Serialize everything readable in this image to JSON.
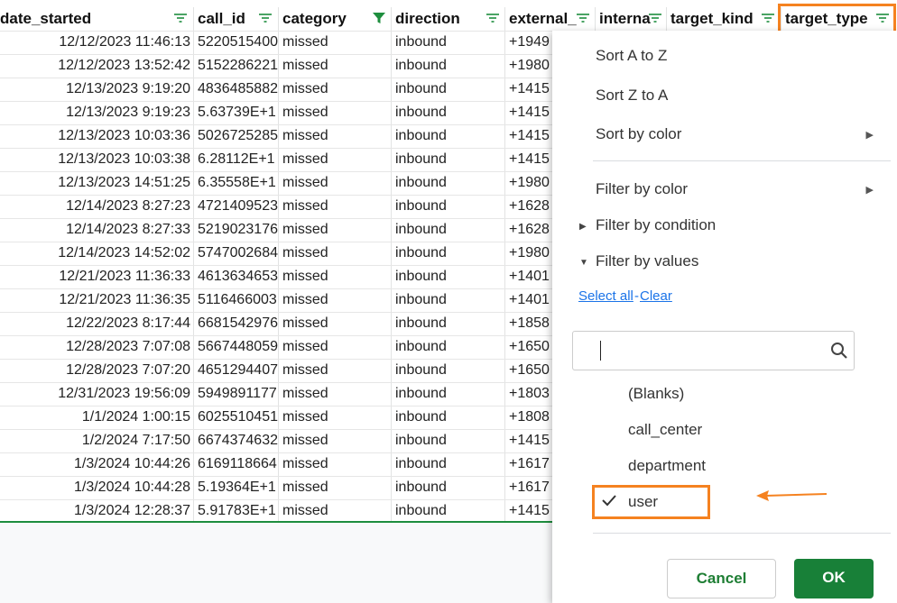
{
  "columns": [
    {
      "label": "date_started"
    },
    {
      "label": "call_id"
    },
    {
      "label": "category"
    },
    {
      "label": "direction"
    },
    {
      "label": "external_"
    },
    {
      "label": "interna"
    },
    {
      "label": "target_kind"
    },
    {
      "label": "target_type"
    }
  ],
  "rows": [
    [
      "12/12/2023 11:46:13",
      "5220515400",
      "missed",
      "inbound",
      "+1949"
    ],
    [
      "12/12/2023 13:52:42",
      "5152286221",
      "missed",
      "inbound",
      "+1980"
    ],
    [
      "12/13/2023 9:19:20",
      "4836485882",
      "missed",
      "inbound",
      "+1415"
    ],
    [
      "12/13/2023 9:19:23",
      "5.63739E+1",
      "missed",
      "inbound",
      "+1415"
    ],
    [
      "12/13/2023 10:03:36",
      "5026725285",
      "missed",
      "inbound",
      "+1415"
    ],
    [
      "12/13/2023 10:03:38",
      "6.28112E+1",
      "missed",
      "inbound",
      "+1415"
    ],
    [
      "12/13/2023 14:51:25",
      "6.35558E+1",
      "missed",
      "inbound",
      "+1980"
    ],
    [
      "12/14/2023 8:27:23",
      "4721409523",
      "missed",
      "inbound",
      "+1628"
    ],
    [
      "12/14/2023 8:27:33",
      "5219023176",
      "missed",
      "inbound",
      "+1628"
    ],
    [
      "12/14/2023 14:52:02",
      "5747002684",
      "missed",
      "inbound",
      "+1980"
    ],
    [
      "12/21/2023 11:36:33",
      "4613634653",
      "missed",
      "inbound",
      "+1401"
    ],
    [
      "12/21/2023 11:36:35",
      "5116466003",
      "missed",
      "inbound",
      "+1401"
    ],
    [
      "12/22/2023 8:17:44",
      "6681542976",
      "missed",
      "inbound",
      "+1858"
    ],
    [
      "12/28/2023 7:07:08",
      "5667448059",
      "missed",
      "inbound",
      "+1650"
    ],
    [
      "12/28/2023 7:07:20",
      "4651294407",
      "missed",
      "inbound",
      "+1650"
    ],
    [
      "12/31/2023 19:56:09",
      "5949891177",
      "missed",
      "inbound",
      "+1803"
    ],
    [
      "1/1/2024 1:00:15",
      "6025510451",
      "missed",
      "inbound",
      "+1808"
    ],
    [
      "1/2/2024 7:17:50",
      "6674374632",
      "missed",
      "inbound",
      "+1415"
    ],
    [
      "1/3/2024 10:44:26",
      "6169118664",
      "missed",
      "inbound",
      "+1617"
    ],
    [
      "1/3/2024 10:44:28",
      "5.19364E+1",
      "missed",
      "inbound",
      "+1617"
    ],
    [
      "1/3/2024 12:28:37",
      "5.91783E+1",
      "missed",
      "inbound",
      "+1415"
    ]
  ],
  "menu": {
    "sort_az": "Sort A to Z",
    "sort_za": "Sort Z to A",
    "sort_color": "Sort by color",
    "filter_color": "Filter by color",
    "filter_condition": "Filter by condition",
    "filter_values": "Filter by values",
    "select_all": "Select all",
    "dash": "-",
    "clear": "Clear",
    "options": [
      "(Blanks)",
      "call_center",
      "department",
      "user"
    ],
    "cancel": "Cancel",
    "ok": "OK"
  },
  "colors": {
    "accent": "#188038",
    "highlight": "#f58220",
    "link": "#1a73e8"
  }
}
